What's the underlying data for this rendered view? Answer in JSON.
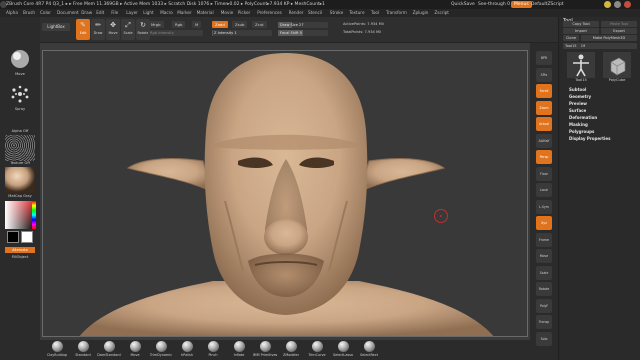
{
  "titlebar": {
    "title": "ZBrush Core 4R7 P4   Q3_1 ▸ ▸ Free Mem 11.369GB ▸ Active Mem 1033 ▸ Scratch Disk 1076 ▸ Timer▸0.02 ▸ PolyCount▸7.934 KP ▸ MeshCount▸1",
    "quicksave": "QuickSave",
    "see_through": "See-through  0",
    "menus": "Menus",
    "default_zscript": "DefaultZScript"
  },
  "menubar": {
    "items": [
      "Alpha",
      "Brush",
      "Color",
      "Document",
      "Draw",
      "Edit",
      "File",
      "Layer",
      "Light",
      "Macro",
      "Marker",
      "Material",
      "Movie",
      "Picker",
      "Preferences",
      "Render",
      "Stencil",
      "Stroke",
      "Texture",
      "Tool",
      "Transform",
      "Zplugin",
      "Zscript"
    ]
  },
  "shelf": {
    "home_page": "Home Page",
    "lightbox": "LightBox",
    "tools": [
      {
        "label": "Edit",
        "glyph": "✎",
        "active": true
      },
      {
        "label": "Draw",
        "glyph": "✏",
        "active": false
      },
      {
        "label": "Move",
        "glyph": "✥",
        "active": false
      },
      {
        "label": "Scale",
        "glyph": "⤢",
        "active": false
      },
      {
        "label": "Rotate",
        "glyph": "↻",
        "active": false
      }
    ],
    "mrgb": "Mrgb",
    "rgb": "Rgb",
    "m": "M",
    "zadd": "Zadd",
    "zsub": "Zsub",
    "zcut": "Zcut",
    "rgb_intensity": "Rgb Intensity",
    "z_intensity": "Z Intensity 1",
    "z_intensity_level": 0.02,
    "draw_size": "Draw Size 27",
    "draw_size_level": 0.27,
    "focal_shift": "Focal Shift 0",
    "focal_shift_level": 0.5,
    "active_points": "ActivePoints: 7.934 Mil",
    "total_points": "TotalPoints: 7.934 Mil"
  },
  "left": {
    "brush1": "Move",
    "brush2": "Spray",
    "alpha": "Alpha Off",
    "texture": "Texture Off",
    "material": "MatCap Gray",
    "gradient": "Gradient",
    "switch_color": "SwitchColor",
    "alternate": "Alternate",
    "fill_object": "FillObject"
  },
  "right": {
    "buttons": [
      {
        "label": "BPR",
        "active": false
      },
      {
        "label": "SPix",
        "active": false
      },
      {
        "label": "Scroll",
        "active": true
      },
      {
        "label": "Zoom",
        "active": true
      },
      {
        "label": "Actual",
        "active": true
      },
      {
        "label": "AAHalf",
        "active": false
      },
      {
        "label": "Persp",
        "active": true
      },
      {
        "label": "Floor",
        "active": false
      },
      {
        "label": "Local",
        "active": false
      },
      {
        "label": "L.Sym",
        "active": false
      },
      {
        "label": "Xyz",
        "active": true
      },
      {
        "label": "Frame",
        "active": false
      },
      {
        "label": "Move",
        "active": false
      },
      {
        "label": "Scale",
        "active": false
      },
      {
        "label": "Rotate",
        "active": false
      },
      {
        "label": "PolyF",
        "active": false
      },
      {
        "label": "Transp",
        "active": false
      },
      {
        "label": "Solo",
        "active": false
      }
    ]
  },
  "palette": {
    "title": "Tool",
    "copy_tool": "Copy Tool",
    "paste_tool": "Paste Tool",
    "import": "Import",
    "export": "Export",
    "clone": "Clone",
    "make_polymesh": "Make PolyMesh3D",
    "slider_label": "Tool15",
    "slider_value": "19",
    "thumb1_label": "Tool15",
    "thumb2_label": "PolyCube",
    "items": [
      "Subtool",
      "Geometry",
      "Preview",
      "Surface",
      "Deformation",
      "Masking",
      "Polygroups",
      "Display Properties"
    ]
  },
  "bottom": {
    "brushes": [
      {
        "label": "ClayBuildup"
      },
      {
        "label": "Standard"
      },
      {
        "label": "DamStandard"
      },
      {
        "label": "Move"
      },
      {
        "label": "TrimDynamic"
      },
      {
        "label": "hPolish"
      },
      {
        "label": "Pinch"
      },
      {
        "label": "Inflate"
      },
      {
        "label": "IMM Primitives"
      },
      {
        "label": "ZModeler"
      },
      {
        "label": "TrimCurve"
      },
      {
        "label": "SelectLasso"
      },
      {
        "label": "SelectRect"
      }
    ]
  },
  "colors": {
    "accent": "#e0731c",
    "skin": "#c9a584",
    "cursor": "#c0302c"
  }
}
